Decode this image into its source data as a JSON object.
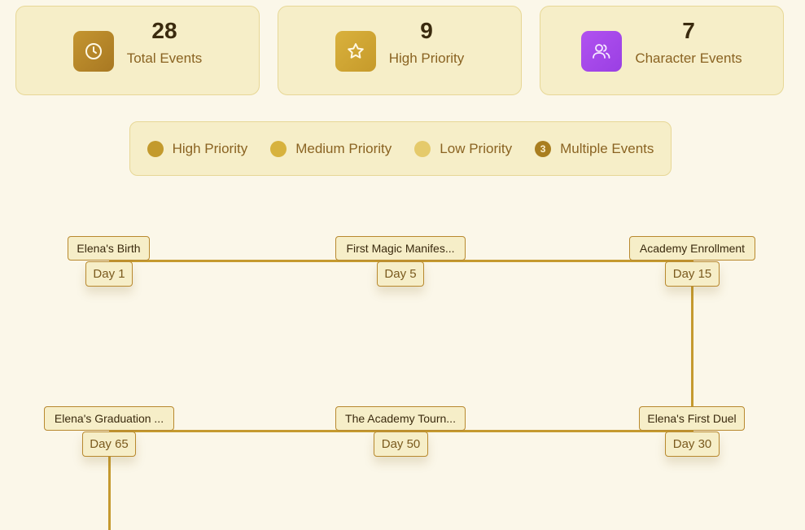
{
  "stats": [
    {
      "value": "28",
      "label": "Total Events",
      "icon": "clock-icon",
      "color": "#b8862a"
    },
    {
      "value": "9",
      "label": "High Priority",
      "icon": "star-icon",
      "color": "#d2a731"
    },
    {
      "value": "7",
      "label": "Character Events",
      "icon": "users-icon",
      "color": "#a14ae8"
    }
  ],
  "legend": {
    "high": {
      "label": "High Priority",
      "color": "#c39a2d"
    },
    "medium": {
      "label": "Medium Priority",
      "color": "#d7b23e"
    },
    "low": {
      "label": "Low Priority",
      "color": "#e5ca6b"
    },
    "multiple": {
      "label": "Multiple Events",
      "count": "3"
    }
  },
  "timeline": {
    "events": [
      {
        "title": "Elena's Birth",
        "day": "Day 1"
      },
      {
        "title": "First Magic Manifes...",
        "day": "Day 5"
      },
      {
        "title": "Academy Enrollment",
        "day": "Day 15"
      },
      {
        "title": "Elena's First Duel",
        "day": "Day 30"
      },
      {
        "title": "The Academy Tourn...",
        "day": "Day 50"
      },
      {
        "title": "Elena's Graduation ...",
        "day": "Day 65"
      }
    ]
  }
}
